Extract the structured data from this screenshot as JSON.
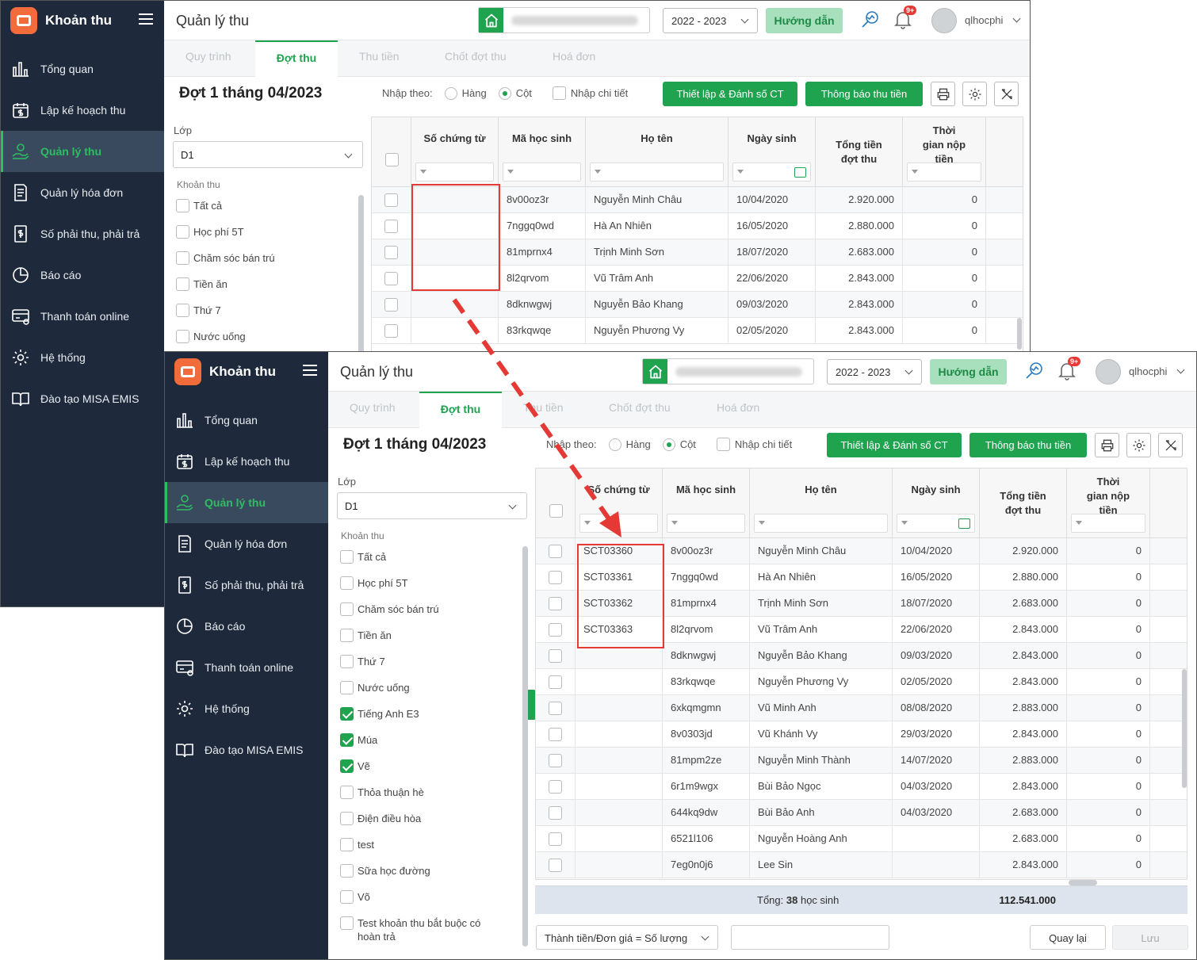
{
  "app": {
    "name": "Khoản thu"
  },
  "nav": [
    {
      "label": "Tổng quan",
      "icon": "bar-chart-icon"
    },
    {
      "label": "Lập kế hoạch thu",
      "icon": "calendar-dollar-icon"
    },
    {
      "label": "Quản lý thu",
      "icon": "hand-coin-icon",
      "active": true
    },
    {
      "label": "Quản lý hóa đơn",
      "icon": "invoice-icon"
    },
    {
      "label": "Số phải thu, phải trả",
      "icon": "ledger-icon"
    },
    {
      "label": "Báo cáo",
      "icon": "pie-chart-icon"
    },
    {
      "label": "Thanh toán online",
      "icon": "card-payment-icon"
    },
    {
      "label": "Hệ thống",
      "icon": "gear-icon"
    },
    {
      "label": "Đào tạo MISA EMIS",
      "icon": "book-icon"
    }
  ],
  "header": {
    "title": "Quản lý thu",
    "year": "2022 - 2023",
    "guide": "Hướng dẫn",
    "notif_badge": "9+",
    "user": "qlhocphi"
  },
  "tabs": [
    "Quy trình",
    "Đợt thu",
    "Thu tiền",
    "Chốt đợt thu",
    "Hoá đơn"
  ],
  "toolbar": {
    "title": "Đợt 1 tháng 04/2023",
    "nhap_theo": "Nhập theo:",
    "hang": "Hàng",
    "cot": "Cột",
    "chi_tiet": "Nhập chi tiết",
    "btn_setup": "Thiết lập & Đánh số CT",
    "btn_notify": "Thông báo thu tiền"
  },
  "filters": {
    "lop_label": "Lớp",
    "lop_value": "D1",
    "khoan_thu_label": "Khoản thu",
    "items": [
      {
        "label": "Tất cả",
        "checked": false
      },
      {
        "label": "Học phí 5T",
        "checked": false
      },
      {
        "label": "Chăm sóc bán trú",
        "checked": false
      },
      {
        "label": "Tiền ăn",
        "checked": false
      },
      {
        "label": "Thứ 7",
        "checked": false
      },
      {
        "label": "Nước uống",
        "checked": false
      },
      {
        "label": "Tiếng Anh E3",
        "checked": true
      },
      {
        "label": "Múa",
        "checked": true
      },
      {
        "label": "Vẽ",
        "checked": true
      },
      {
        "label": "Thỏa thuận hè",
        "checked": false
      },
      {
        "label": "Điện điều hòa",
        "checked": false
      },
      {
        "label": "test",
        "checked": false
      },
      {
        "label": "Sữa học đường",
        "checked": false
      },
      {
        "label": "Võ",
        "checked": false
      },
      {
        "label": "Test khoản thu bắt buộc có hoàn trả",
        "checked": false
      }
    ]
  },
  "table": {
    "headers": [
      "Số chứng từ",
      "Mã học sinh",
      "Họ tên",
      "Ngày sinh",
      "Tổng tiền đợt thu",
      "Thời gian nộp tiền"
    ],
    "rows_before": [
      {
        "so_ct": "",
        "ma": "8v00oz3r",
        "ten": "Nguyễn Minh Châu",
        "ngay": "10/04/2020",
        "tong": "2.920.000",
        "tg": "0"
      },
      {
        "so_ct": "",
        "ma": "7nggq0wd",
        "ten": "Hà An Nhiên",
        "ngay": "16/05/2020",
        "tong": "2.880.000",
        "tg": "0"
      },
      {
        "so_ct": "",
        "ma": "81mprnx4",
        "ten": "Trịnh Minh Sơn",
        "ngay": "18/07/2020",
        "tong": "2.683.000",
        "tg": "0"
      },
      {
        "so_ct": "",
        "ma": "8l2qrvom",
        "ten": "Vũ Trâm Anh",
        "ngay": "22/06/2020",
        "tong": "2.843.000",
        "tg": "0"
      },
      {
        "so_ct": "",
        "ma": "8dknwgwj",
        "ten": "Nguyễn Bảo Khang",
        "ngay": "09/03/2020",
        "tong": "2.843.000",
        "tg": "0"
      },
      {
        "so_ct": "",
        "ma": "83rkqwqe",
        "ten": "Nguyễn Phương Vy",
        "ngay": "02/05/2020",
        "tong": "2.843.000",
        "tg": "0"
      }
    ],
    "rows_after": [
      {
        "so_ct": "SCT03360",
        "ma": "8v00oz3r",
        "ten": "Nguyễn Minh Châu",
        "ngay": "10/04/2020",
        "tong": "2.920.000",
        "tg": "0"
      },
      {
        "so_ct": "SCT03361",
        "ma": "7nggq0wd",
        "ten": "Hà An Nhiên",
        "ngay": "16/05/2020",
        "tong": "2.880.000",
        "tg": "0"
      },
      {
        "so_ct": "SCT03362",
        "ma": "81mprnx4",
        "ten": "Trịnh Minh Sơn",
        "ngay": "18/07/2020",
        "tong": "2.683.000",
        "tg": "0"
      },
      {
        "so_ct": "SCT03363",
        "ma": "8l2qrvom",
        "ten": "Vũ Trâm Anh",
        "ngay": "22/06/2020",
        "tong": "2.843.000",
        "tg": "0"
      },
      {
        "so_ct": "",
        "ma": "8dknwgwj",
        "ten": "Nguyễn Bảo Khang",
        "ngay": "09/03/2020",
        "tong": "2.843.000",
        "tg": "0"
      },
      {
        "so_ct": "",
        "ma": "83rkqwqe",
        "ten": "Nguyễn Phương Vy",
        "ngay": "02/05/2020",
        "tong": "2.843.000",
        "tg": "0"
      },
      {
        "so_ct": "",
        "ma": "6xkqmgmn",
        "ten": "Vũ Minh Anh",
        "ngay": "08/08/2020",
        "tong": "2.883.000",
        "tg": "0"
      },
      {
        "so_ct": "",
        "ma": "8v0303jd",
        "ten": "Vũ Khánh Vy",
        "ngay": "29/03/2020",
        "tong": "2.843.000",
        "tg": "0"
      },
      {
        "so_ct": "",
        "ma": "81mpm2ze",
        "ten": "Nguyễn Minh Thành",
        "ngay": "14/07/2020",
        "tong": "2.883.000",
        "tg": "0"
      },
      {
        "so_ct": "",
        "ma": "6r1m9wgx",
        "ten": "Bùi Bảo Ngọc",
        "ngay": "04/03/2020",
        "tong": "2.843.000",
        "tg": "0"
      },
      {
        "so_ct": "",
        "ma": "644kq9dw",
        "ten": "Bùi Bảo Anh",
        "ngay": "04/03/2020",
        "tong": "2.683.000",
        "tg": "0"
      },
      {
        "so_ct": "",
        "ma": "6521l106",
        "ten": "Nguyễn Hoàng Anh",
        "ngay": "",
        "tong": "2.683.000",
        "tg": "0"
      },
      {
        "so_ct": "",
        "ma": "7eg0n0j6",
        "ten": "Lee Sin",
        "ngay": "",
        "tong": "2.843.000",
        "tg": "0"
      }
    ],
    "footer_label": "Tổng:",
    "footer_count": "38",
    "footer_suffix": "học sinh",
    "footer_total": "112.541.000"
  },
  "bottom": {
    "formula": "Thành tiền/Đơn giá = Số lượng",
    "back": "Quay lại",
    "save": "Lưu"
  },
  "colors": {
    "accent": "#1fa34f",
    "sidebar": "#1e2a3b",
    "highlight": "#e53935"
  }
}
